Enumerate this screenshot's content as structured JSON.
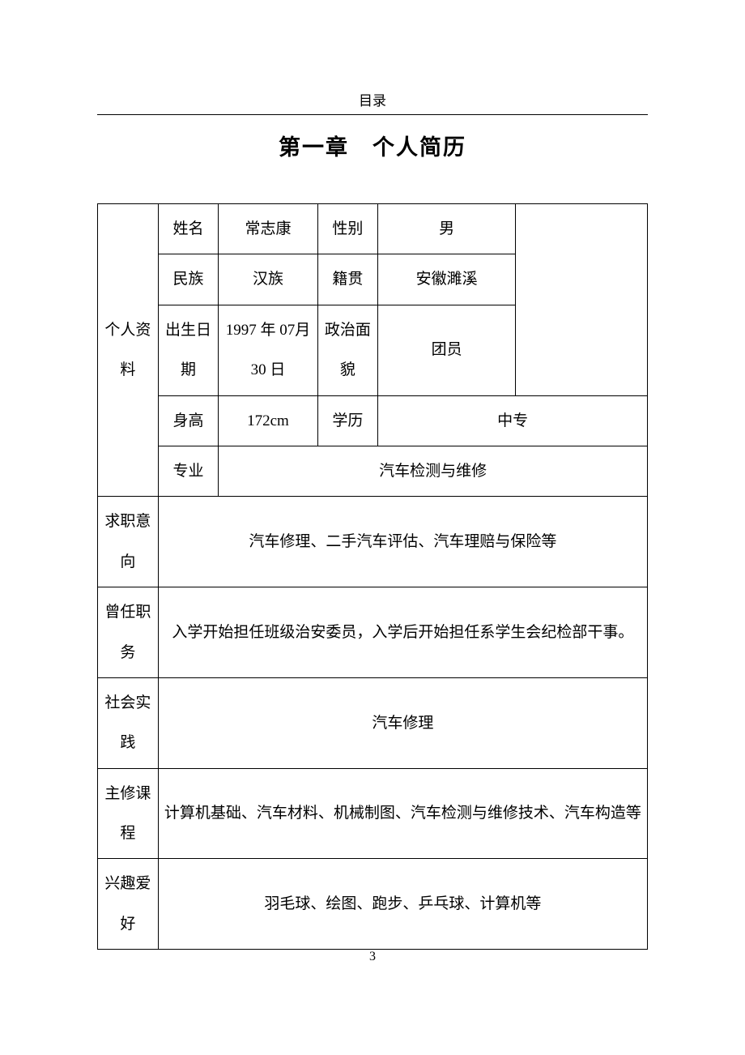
{
  "header": "目录",
  "title": "第一章　个人简历",
  "section_label": "个人资料",
  "rows": {
    "name_label": "姓名",
    "name_value": "常志康",
    "gender_label": "性别",
    "gender_value": "男",
    "ethnic_label": "民族",
    "ethnic_value": "汉族",
    "origin_label": "籍贯",
    "origin_value": "安徽濉溪",
    "birth_label": "出生日期",
    "birth_value": "1997 年 07月 30 日",
    "political_label": "政治面貌",
    "political_value": "团员",
    "height_label": "身高",
    "height_value": "172cm",
    "edu_label": "学历",
    "edu_value": "中专",
    "major_label": "专业",
    "major_value": "汽车检测与维修"
  },
  "job_label": "求职意向",
  "job_value": "汽车修理、二手汽车评估、汽车理赔与保险等",
  "position_label": "曾任职务",
  "position_value": "入学开始担任班级治安委员，入学后开始担任系学生会纪检部干事。",
  "practice_label": "社会实践",
  "practice_value": "汽车修理",
  "course_label": "主修课程",
  "course_value": "计算机基础、汽车材料、机械制图、汽车检测与维修技术、汽车构造等",
  "hobby_label": "兴趣爱好",
  "hobby_value": "羽毛球、绘图、跑步、乒乓球、计算机等",
  "page_number": "3"
}
